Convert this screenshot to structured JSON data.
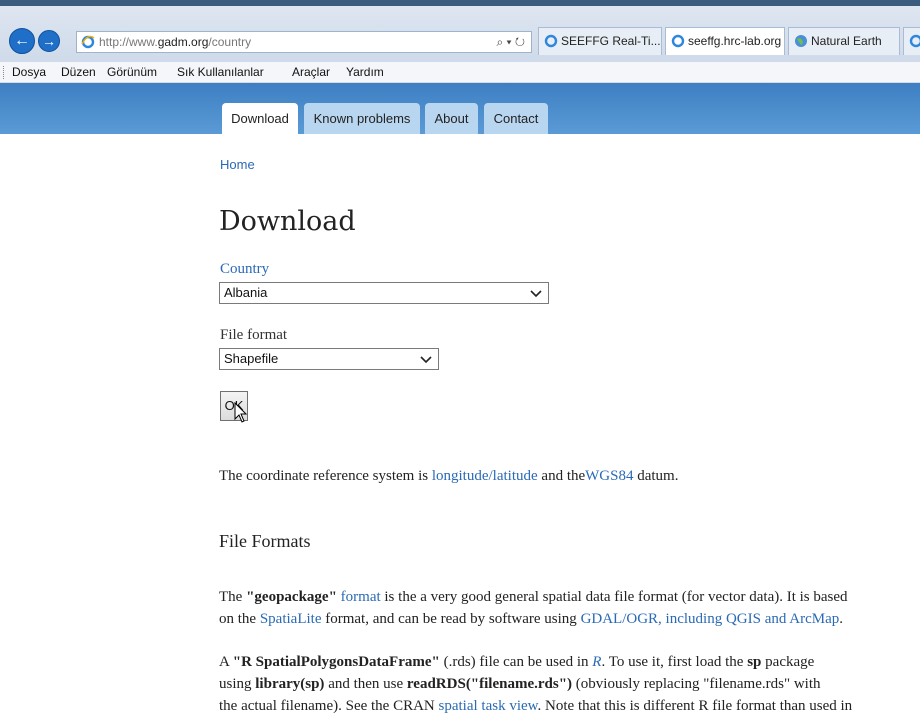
{
  "browser": {
    "url_prefix": "http://www.",
    "url_domain": "gadm.org",
    "url_path": "/country",
    "addr_tools": "⌕ ▾ ↻",
    "tabs": [
      {
        "label": "SEEFFG Real-Ti..."
      },
      {
        "label": "seeffg.hrc-lab.org"
      },
      {
        "label": "Natural Earth"
      }
    ],
    "menu": [
      "Dosya",
      "Düzen",
      "Görünüm",
      "Sık Kullanılanlar",
      "Araçlar",
      "Yardım"
    ]
  },
  "site": {
    "tabs": [
      "Download",
      "Known problems",
      "About",
      "Contact"
    ],
    "breadcrumb": "Home",
    "title": "Download",
    "country_label": "Country",
    "country_value": "Albania",
    "format_label": "File format",
    "format_value": "Shapefile",
    "ok_label": "OK",
    "crs": {
      "before": "The coordinate reference system is ",
      "link1": "longitude/latitude",
      "middle": " and the",
      "link2": "WGS84",
      "after": " datum."
    },
    "file_formats_heading": "File Formats",
    "geo": {
      "l1_a": "The ",
      "l1_bold": "\"geopackage\"",
      "l1_link": "format",
      "l1_b": " is the a very good general spatial data file format (for vector data). It is based",
      "l2_a": "on the ",
      "l2_link1": "SpatiaLite",
      "l2_b": " format, and can be read by software using ",
      "l2_link2": "GDAL/OGR, including QGIS and ArcMap",
      "l2_c": "."
    },
    "r": {
      "l1_a": "A ",
      "l1_bold": "\"R SpatialPolygonsDataFrame\"",
      "l1_b": " (.rds) file can be used in ",
      "l1_link": "R",
      "l1_c": ". To use it, first load the ",
      "l1_bold2": "sp",
      "l1_d": " package",
      "l2_a": "using ",
      "l2_bold1": "library(sp)",
      "l2_b": " and then use ",
      "l2_bold2": "readRDS(\"filename.rds\")",
      "l2_c": " (obviously replacing \"filename.rds\" with",
      "l3_a": "the actual filename). See the CRAN ",
      "l3_link": "spatial task view",
      "l3_b": ". Note that this is different R file format than used in"
    }
  }
}
